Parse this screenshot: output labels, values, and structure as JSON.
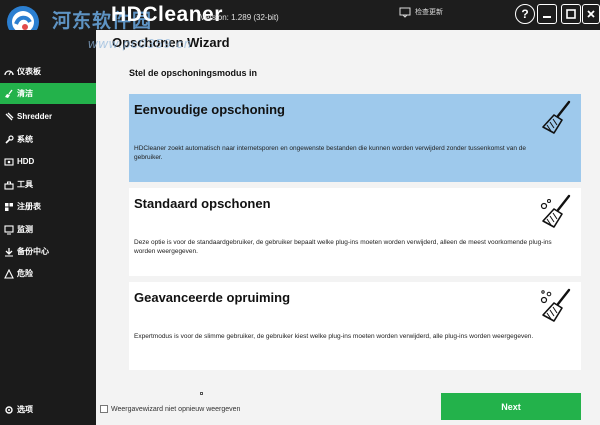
{
  "titlebar": {
    "watermark": "河东软件园",
    "watermark_url": "www.pc0359.cn",
    "app_title": "HDCleaner",
    "version": "Version: 1.289 (32-bit)",
    "feedback": "检查更新",
    "help": "?"
  },
  "sidebar": {
    "items": [
      {
        "label": "仪表板",
        "icon": "dashboard-icon"
      },
      {
        "label": "清洁",
        "icon": "broom-icon",
        "active": true
      },
      {
        "label": "Shredder",
        "icon": "shredder-icon"
      },
      {
        "label": "系统",
        "icon": "wrench-icon"
      },
      {
        "label": "HDD",
        "icon": "hdd-icon"
      },
      {
        "label": "工具",
        "icon": "tools-icon"
      },
      {
        "label": "注册表",
        "icon": "registry-icon"
      },
      {
        "label": "监测",
        "icon": "monitor-icon"
      },
      {
        "label": "备份中心",
        "icon": "backup-icon"
      },
      {
        "label": "危险",
        "icon": "danger-icon"
      }
    ],
    "footer": {
      "label": "选项",
      "icon": "options-icon"
    }
  },
  "main": {
    "wizard_title": "Opschonen Wizard",
    "subtitle": "Stel de opschoningsmodus in",
    "options": [
      {
        "title": "Eenvoudige opschoning",
        "description": "HDCleaner zoekt automatisch naar internetsporen en ongewenste bestanden die kunnen worden verwijderd zonder tussenkomst van de gebruiker.",
        "selected": true
      },
      {
        "title": "Standaard opschonen",
        "description": "Deze optie is voor de standaardgebruiker, de gebruiker bepaalt welke plug-ins moeten worden verwijderd, alleen de meest voorkomende plug-ins worden weergegeven.",
        "selected": false
      },
      {
        "title": "Geavanceerde opruiming",
        "description": "Expertmodus is voor de slimme gebruiker, de gebruiker kiest welke plug-ins moeten worden verwijderd, alle plug-ins worden weergegeven.",
        "selected": false
      }
    ],
    "checkbox_label": "Weergavewizard niet opnieuw weergeven",
    "next_label": "Next"
  },
  "colors": {
    "accent": "#23b24b",
    "selected": "#9ec9ec",
    "sidebar_bg": "#1b1b1b",
    "titlebar_bg": "#1d1d1d"
  }
}
